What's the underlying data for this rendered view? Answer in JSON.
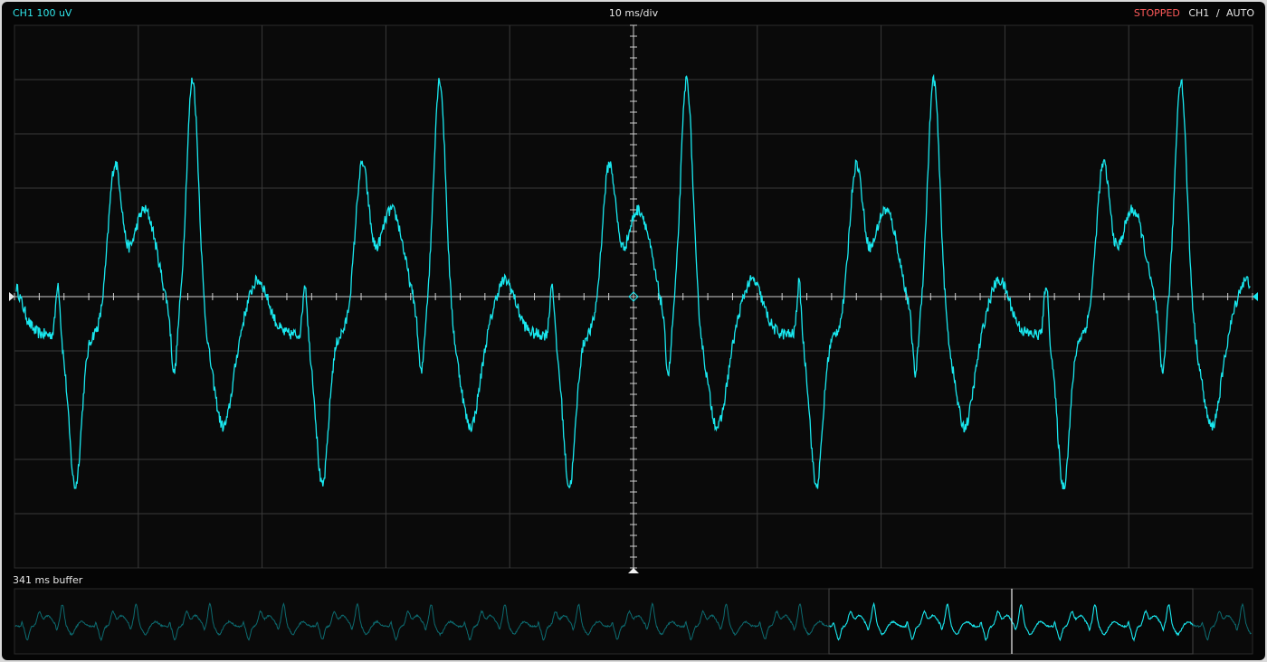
{
  "header": {
    "channel_scale": "CH1 100 uV",
    "timebase": "10 ms/div",
    "state": "STOPPED",
    "trigger_channel": "CH1",
    "trigger_mode": "AUTO"
  },
  "buffer": {
    "label": "341 ms buffer"
  },
  "colors": {
    "trace": "#19e8ef",
    "trace_dim": "#0c6b70",
    "grid": "#3a3a3a",
    "axis": "#cfcfcf",
    "stopped": "#ff5a5a"
  },
  "icons": {
    "trigger_slope": "rising-edge-icon",
    "trigger_level_left": "triangle-right-icon",
    "trigger_level_right": "triangle-left-icon",
    "trigger_position": "triangle-up-icon",
    "center_marker": "diamond-icon"
  }
}
